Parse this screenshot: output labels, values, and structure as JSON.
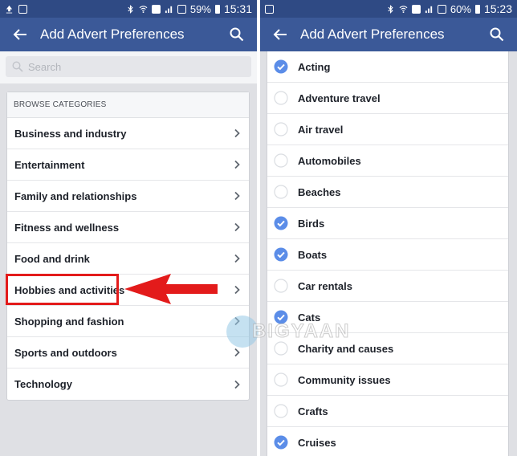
{
  "left_screen": {
    "status_bar": {
      "left_icons": [
        "upload-icon",
        "image-icon"
      ],
      "right_icons": [
        "bluetooth-icon",
        "wifi-icon",
        "sim-icon",
        "signal-icon",
        "signal-box-icon"
      ],
      "battery": "59%",
      "time": "15:31"
    },
    "app_bar": {
      "title": "Add Advert Preferences",
      "back_icon": "arrow-left-icon",
      "search_icon": "search-icon"
    },
    "search": {
      "placeholder": "Search"
    },
    "browse": {
      "header": "BROWSE CATEGORIES",
      "categories": [
        {
          "label": "Business and industry"
        },
        {
          "label": "Entertainment"
        },
        {
          "label": "Family and relationships"
        },
        {
          "label": "Fitness and wellness"
        },
        {
          "label": "Food and drink"
        },
        {
          "label": "Hobbies and activities",
          "highlighted": true
        },
        {
          "label": "Shopping and fashion"
        },
        {
          "label": "Sports and outdoors"
        },
        {
          "label": "Technology"
        }
      ]
    },
    "annotation": {
      "highlight_color": "#e31b1b",
      "arrow_color": "#e31b1b",
      "target": "Hobbies and activities"
    }
  },
  "right_screen": {
    "status_bar": {
      "left_icons": [
        "image-icon"
      ],
      "right_icons": [
        "bluetooth-icon",
        "wifi-icon",
        "sim-icon",
        "signal-icon",
        "signal-box-icon"
      ],
      "battery": "60%",
      "time": "15:23"
    },
    "app_bar": {
      "title": "Add Advert Preferences",
      "back_icon": "arrow-left-icon",
      "search_icon": "search-icon"
    },
    "interests": [
      {
        "label": "Acting",
        "checked": true
      },
      {
        "label": "Adventure travel",
        "checked": false
      },
      {
        "label": "Air travel",
        "checked": false
      },
      {
        "label": "Automobiles",
        "checked": false
      },
      {
        "label": "Beaches",
        "checked": false
      },
      {
        "label": "Birds",
        "checked": true
      },
      {
        "label": "Boats",
        "checked": true
      },
      {
        "label": "Car rentals",
        "checked": false
      },
      {
        "label": "Cats",
        "checked": true
      },
      {
        "label": "Charity and causes",
        "checked": false
      },
      {
        "label": "Community issues",
        "checked": false
      },
      {
        "label": "Crafts",
        "checked": false
      },
      {
        "label": "Cruises",
        "checked": true
      }
    ]
  },
  "watermark": {
    "text": "BIGYAAN"
  },
  "colors": {
    "status_bar": "#2f4a84",
    "app_bar": "#3b5998",
    "check_blue": "#5b8de8",
    "background": "#dfe0e4"
  }
}
